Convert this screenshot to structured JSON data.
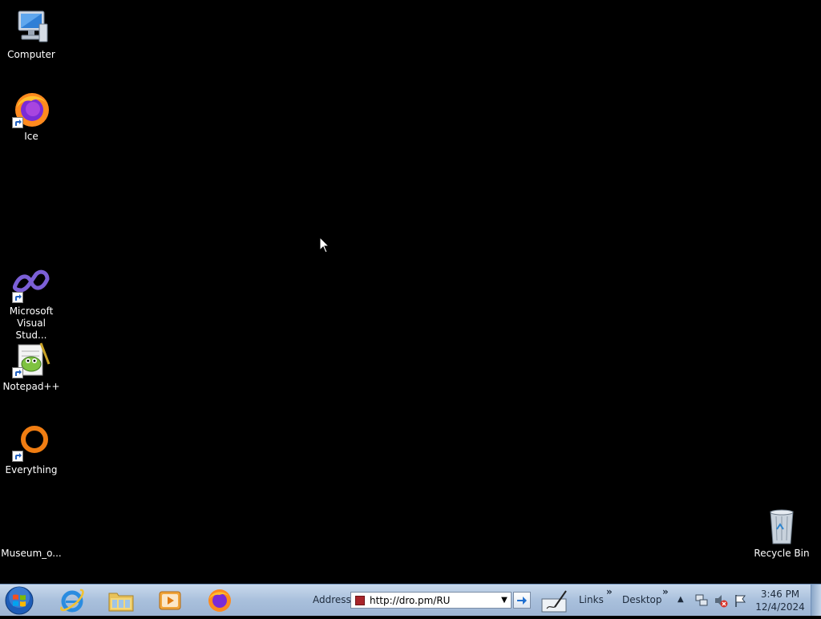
{
  "desktop": {
    "icons": [
      {
        "label": "Computer",
        "icon": "computer-icon"
      },
      {
        "label": "Ice",
        "icon": "firefox-icon"
      },
      {
        "label": "Microsoft Visual Stud...",
        "icon": "visual-studio-icon"
      },
      {
        "label": "Notepad++",
        "icon": "notepad-plus-plus-icon"
      },
      {
        "label": "Everything",
        "icon": "everything-search-icon"
      },
      {
        "label": "Museum_o...",
        "icon": "blank-file-icon"
      },
      {
        "label": "Recycle Bin",
        "icon": "recycle-bin-icon"
      }
    ]
  },
  "taskbar": {
    "pinned": [
      "internet-explorer-icon",
      "file-explorer-icon",
      "media-player-icon",
      "firefox-icon"
    ],
    "address_label": "Address",
    "address_value": "http://dro.pm/RU",
    "links_label": "Links",
    "desktop_label": "Desktop",
    "chevron": "»",
    "clock_time": "3:46 PM",
    "clock_date": "12/4/2024"
  },
  "colors": {
    "desktop_bg": "#000000",
    "taskbar_bg": "#a9c0dc"
  }
}
